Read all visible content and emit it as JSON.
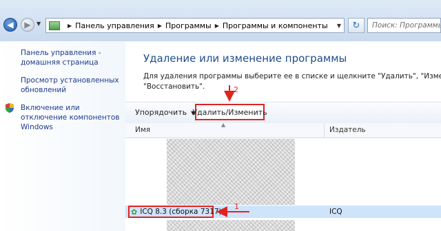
{
  "address_bar": {
    "back_label": "◀",
    "forward_label": "▶",
    "crumbs": [
      "Панель управления",
      "Программы",
      "Программы и компоненты"
    ],
    "search_placeholder": "Поиск: Программы и ..."
  },
  "sidebar": {
    "items": [
      {
        "label": "Панель управления - домашняя страница"
      },
      {
        "label": "Просмотр установленных обновлений"
      },
      {
        "label": "Включение или отключение компонентов Windows"
      }
    ]
  },
  "main": {
    "title": "Удаление или изменение программы",
    "description_line1": "Для удаления программы выберите ее в списке и щелкните \"Удалить\", \"Изменить\" или",
    "description_line2": "\"Восстановить\"."
  },
  "toolbar": {
    "organize_label": "Упорядочить",
    "uninstall_label": "Удалить/Изменить"
  },
  "table": {
    "columns": [
      "Имя",
      "Издатель"
    ],
    "rows": [
      {
        "name": "ICQ 8.3 (сборка 7317)",
        "publisher": "ICQ"
      }
    ]
  },
  "annotations": {
    "step1": "1",
    "step2": "2",
    "color": "#e0231f"
  }
}
